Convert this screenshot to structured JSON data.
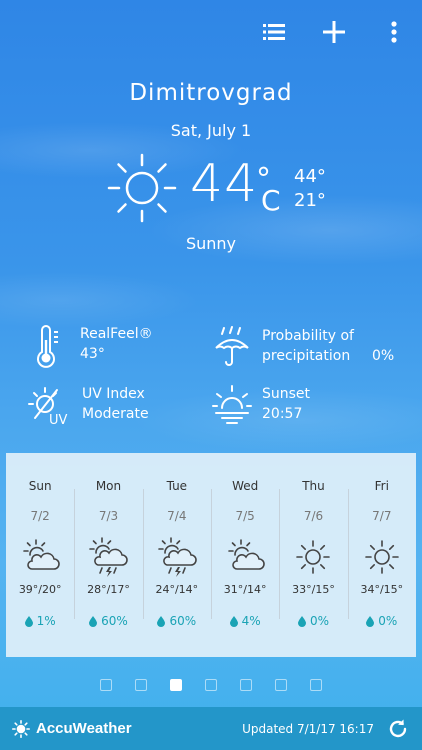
{
  "header": {
    "list_icon": "list-icon",
    "add_icon": "plus-icon",
    "menu_icon": "more-vertical-icon"
  },
  "location": {
    "city": "Dimitrovgrad",
    "date": "Sat, July 1"
  },
  "current": {
    "icon": "sun-icon",
    "temperature": "44",
    "unit_degree": "°",
    "unit_c": "C",
    "high": "44°",
    "low": "21°",
    "condition": "Sunny"
  },
  "details": {
    "realfeel_label": "RealFeel®",
    "realfeel_value": "43°",
    "precip_label_line1": "Probability of",
    "precip_label_line2": "precipitation",
    "precip_value": "0%",
    "uv_label": "UV Index",
    "uv_value": "Moderate",
    "sunset_label": "Sunset",
    "sunset_value": "20:57"
  },
  "forecast": [
    {
      "day": "Sun",
      "date": "7/2",
      "icon": "partly-cloudy-icon",
      "temps": "39°/20°",
      "precip": "1%"
    },
    {
      "day": "Mon",
      "date": "7/3",
      "icon": "thunderstorm-icon",
      "temps": "28°/17°",
      "precip": "60%"
    },
    {
      "day": "Tue",
      "date": "7/4",
      "icon": "thunderstorm-icon",
      "temps": "24°/14°",
      "precip": "60%"
    },
    {
      "day": "Wed",
      "date": "7/5",
      "icon": "partly-cloudy-icon",
      "temps": "31°/14°",
      "precip": "4%"
    },
    {
      "day": "Thu",
      "date": "7/6",
      "icon": "sun-icon",
      "temps": "33°/15°",
      "precip": "0%"
    },
    {
      "day": "Fri",
      "date": "7/7",
      "icon": "sun-icon",
      "temps": "34°/15°",
      "precip": "0%"
    }
  ],
  "pager": {
    "count": 7,
    "active_index": 2
  },
  "footer": {
    "brand": "AccuWeather",
    "updated": "Updated 7/1/17 16:17",
    "refresh_icon": "refresh-icon"
  },
  "colors": {
    "accent": "#1aa3b5",
    "footer_bg": "#2396c9"
  }
}
